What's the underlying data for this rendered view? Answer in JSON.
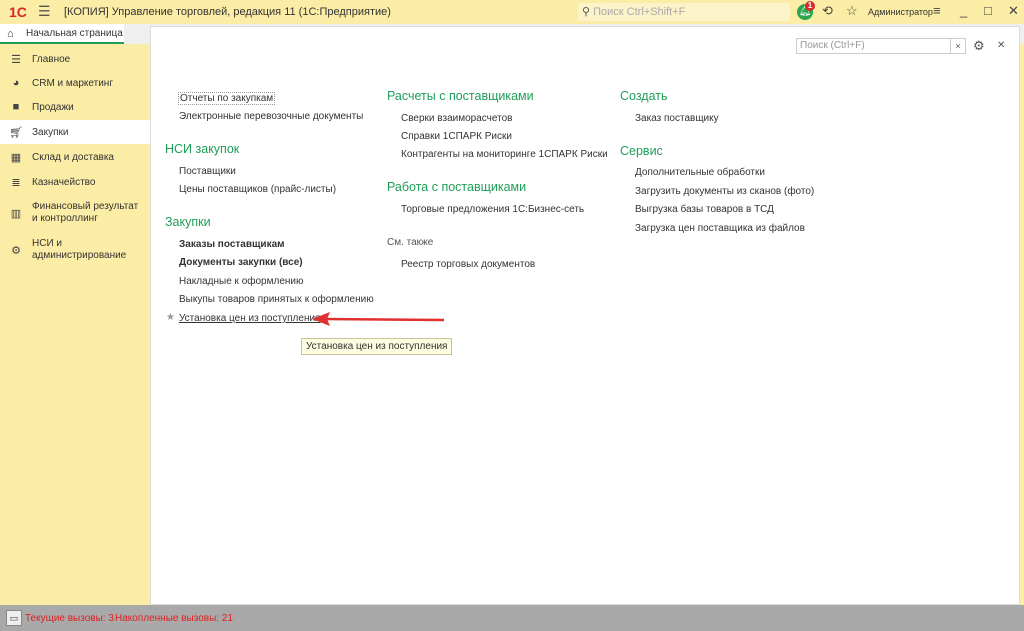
{
  "titlebar": {
    "logo": "1С",
    "title": "[КОПИЯ] Управление торговлей, редакция 11  (1С:Предприятие)",
    "search_placeholder": "Поиск Ctrl+Shift+F",
    "notifications": "1",
    "user": "Администратор"
  },
  "home_tab": "Начальная страница",
  "sidebar": {
    "items": [
      {
        "label": "Главное"
      },
      {
        "label": "CRM и маркетинг"
      },
      {
        "label": "Продажи"
      },
      {
        "label": "Закупки"
      },
      {
        "label": "Склад и доставка"
      },
      {
        "label": "Казначейство"
      },
      {
        "label": "Финансовый результат и контроллинг"
      },
      {
        "label": "НСИ и администрирование"
      }
    ]
  },
  "panel": {
    "search_placeholder": "Поиск (Ctrl+F)"
  },
  "col1": {
    "top": [
      "Отчеты по закупкам",
      "Электронные перевозочные документы"
    ],
    "h_nsi": "НСИ закупок",
    "nsi": [
      "Поставщики",
      "Цены поставщиков (прайс-листы)"
    ],
    "h_purch": "Закупки",
    "purch": [
      "Заказы поставщикам",
      "Документы закупки (все)",
      "Накладные к оформлению",
      "Выкупы товаров принятых к оформлению",
      "Установка цен из поступления"
    ]
  },
  "col2": {
    "h_calc": "Расчеты с поставщиками",
    "calc": [
      "Сверки взаиморасчетов",
      "Справки 1СПАРК Риски",
      "Контрагенты на мониторинге 1СПАРК Риски"
    ],
    "h_work": "Работа с поставщиками",
    "work": [
      "Торговые предложения 1С:Бизнес-сеть"
    ],
    "see_also": "См. также",
    "see": [
      "Реестр торговых документов"
    ]
  },
  "col3": {
    "h_create": "Создать",
    "create": [
      "Заказ поставщику"
    ],
    "h_service": "Сервис",
    "service": [
      "Дополнительные обработки",
      "Загрузить документы из сканов (фото)",
      "Выгрузка базы товаров в ТСД",
      "Загрузка цен поставщика из файлов"
    ]
  },
  "tooltip": "Установка цен из поступления",
  "status": {
    "current": "Текущие вызовы: 3",
    "accumulated": "Накопленные вызовы: 21"
  }
}
